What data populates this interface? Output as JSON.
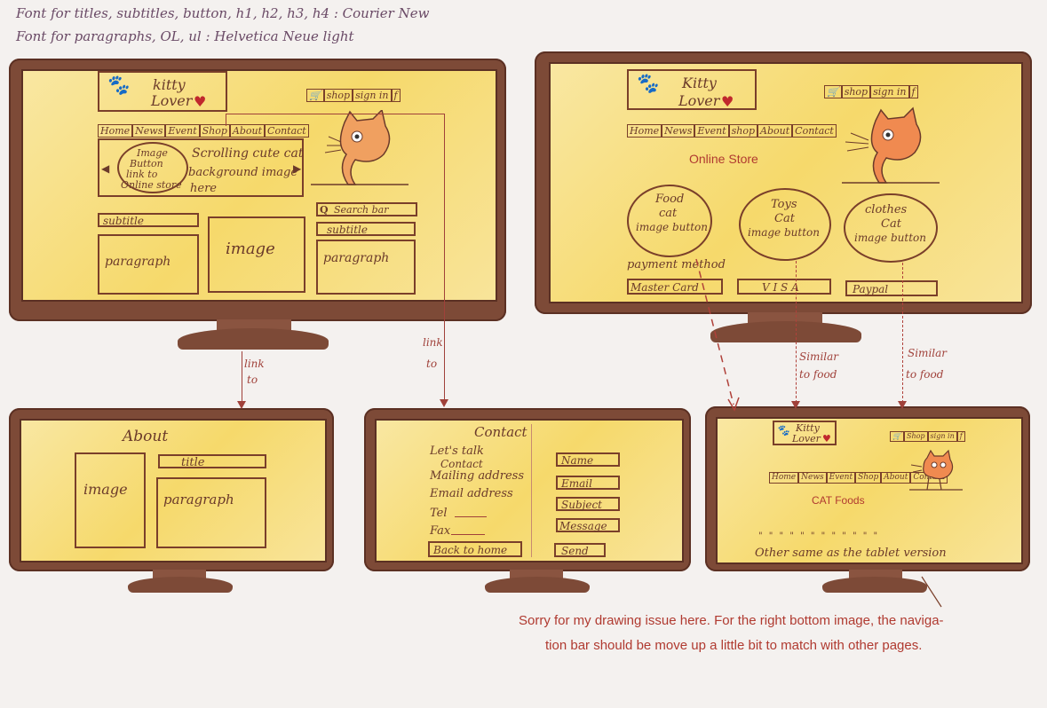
{
  "notes": {
    "font_titles": "Font for titles, subtitles, button, h1, h2, h3, h4 : Courier New",
    "font_paragraphs": "Font for paragraphs, OL, ul : Helvetica Neue light"
  },
  "home": {
    "logo_line1": "kitty",
    "logo_line2": "Lover",
    "heart": "♥",
    "cart_icon": "cart-icon",
    "shop": "shop",
    "sign_in": "sign in",
    "fb": "f",
    "nav": [
      "Home",
      "News",
      "Event",
      "Shop",
      "About",
      "Contact"
    ],
    "carousel_prev": "◀",
    "carousel_next": "▶",
    "oval_text": [
      "Image",
      "Button",
      "link to",
      "Online store"
    ],
    "scroll_text": "Scrolling cute cat",
    "bg_text_1": "background image",
    "bg_text_2": "here",
    "search_icon": "Q",
    "search_bar": "Search bar",
    "subtitle_left": "subtitle",
    "subtitle_right": "subtitle",
    "image": "image",
    "paragraph_left": "paragraph",
    "paragraph_right": "paragraph"
  },
  "store": {
    "logo_line1": "Kitty",
    "logo_line2": "Lover",
    "heart": "♥",
    "shop": "shop",
    "sign_in": "sign in",
    "fb": "f",
    "nav": [
      "Home",
      "News",
      "Event",
      "shop",
      "About",
      "Contact"
    ],
    "title": "Online Store",
    "food": [
      "Food",
      "cat",
      "image button"
    ],
    "toys": [
      "Toys",
      "Cat",
      "image button"
    ],
    "clothes": [
      "clothes",
      "Cat",
      "image button"
    ],
    "payment_label": "payment  method",
    "master": "Master Card",
    "visa": "V I S A",
    "paypal": "Paypal"
  },
  "about": {
    "title": "About",
    "subtitle": "title",
    "image": "image",
    "paragraph": "paragraph"
  },
  "contact": {
    "title": "Contact",
    "lets_talk": "Let's talk",
    "contact": "Contact",
    "mailing": "Mailing address",
    "email": "Email address",
    "tel": "Tel",
    "fax": "Fax",
    "back": "Back to home",
    "fields": [
      "Name",
      "Email",
      "Subject",
      "Message"
    ],
    "send": "Send"
  },
  "foods": {
    "logo_line1": "Kitty",
    "logo_line2": "Lover",
    "heart": "♥",
    "shop": "Shop",
    "sign_in": "sign in",
    "fb": "f",
    "nav": [
      "Home",
      "News",
      "Event",
      "Shop",
      "About",
      "Contact"
    ],
    "title": "CAT Foods",
    "dots": "\" \" \" \" \" \" \" \" \" \" \" \"",
    "other": "Other same as the  tablet  version"
  },
  "links": {
    "link_to_1": "link",
    "link_to_1b": "to",
    "link_to_2": "link",
    "link_to_2b": "to",
    "similar_1": "Similar",
    "similar_1b": "to food",
    "similar_2": "Similar",
    "similar_2b": "to food"
  },
  "apology_line1": "Sorry for my drawing issue here. For the  right bottom image, the naviga-",
  "apology_line2": "tion bar should be move up a little bit to match with other pages."
}
